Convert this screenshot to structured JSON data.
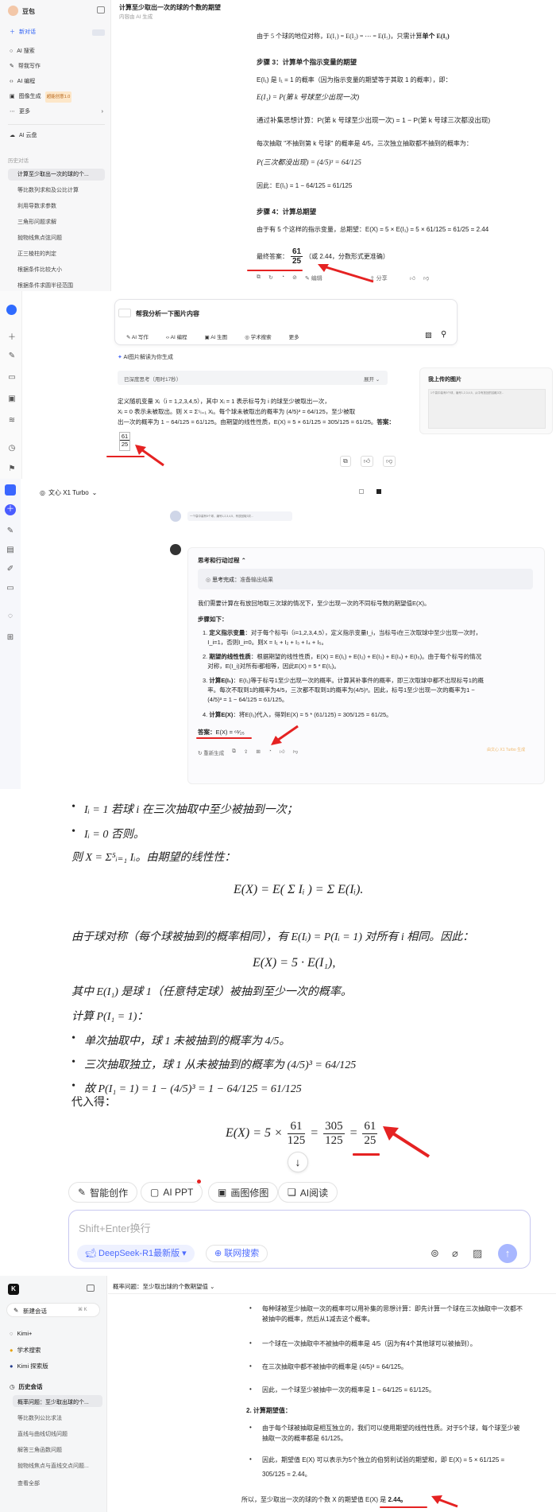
{
  "doubao": {
    "app_name": "豆包",
    "new_chat": "新对话",
    "nav": [
      "AI 搜索",
      "帮我写作",
      "AI 编程",
      "图像生成",
      "更多"
    ],
    "image_badge": "超能创意1.0",
    "cloud": "AI 云盘",
    "history_label": "历史对话",
    "history": [
      "计算至少取出一次的球的个...",
      "等比数列求和及公比计算",
      "利用导数求参数",
      "三角形问题求解",
      "抛物线焦点弦问题",
      "正三棱柱的判定",
      "根据条件比较大小",
      "根据条件求圆半径范围"
    ],
    "title": "计算至少取出一次的球的个数的期望",
    "subtitle": "内容由 AI 生成",
    "line1": "由于 5 个球的地位对称，E(I₁) = E(I₂) = ⋯ = E(I₅)，只需计算",
    "line1_bold": "单个 E(I₁)",
    "step3": "步骤 3：计算单个指示变量的期望",
    "s3a": "E(I₁) 是 I₁ = 1 的概率（因为指示变量的期望等于其取 1 的概率），即：",
    "s3b": "E(I₁) = P(第 k 号球至少出现一次)",
    "s3c": "通过补集思想计算：P(第 k 号球至少出现一次) = 1 − P(第 k 号球三次都没出现)",
    "s3c_bold": "补集思想",
    "s3d": "每次抽取 \"不抽到第 k 号球\" 的概率是 4/5，三次独立抽取都不抽到的概率为：",
    "s3e": "P(三次都没出现) = (4/5)³ = 64/125",
    "s3f": "因此：E(I₁) = 1 − 64/125 = 61/125",
    "step4": "步骤 4：计算总期望",
    "s4a": "由于有 5 个这样的指示变量，总期望：E(X) = 5 × E(I₁) = 5 × 61/125 = 61/25 = 2.44",
    "final_label": "最终答案：",
    "final_num": "61",
    "final_den": "25",
    "final_note": "（或 2.44，分数形式更准确）",
    "edit": "编辑",
    "share": "分享"
  },
  "baidu": {
    "input_placeholder": "帮我分析一下图片内容",
    "tools": [
      "AI 写作",
      "AI 编程",
      "AI 生图",
      "学术搜索",
      "更多"
    ],
    "ai_note": "AI图片解读为你生成",
    "think_label": "已深度思考（用时17秒）",
    "expand": "展开",
    "ans1": "定义随机变量 Xᵢ（i = 1,2,3,4,5），其中 Xᵢ = 1 表示标号为 i 的球至少被取出一次，",
    "ans2": "Xᵢ = 0 表示未被取出。则 X = Σ⁵ᵢ₌₁ Xᵢ。每个球未被取出的概率为 (4/5)³ = 64/125，至少被取",
    "ans3": "出一次的概率为 1 − 64/125 = 61/125。由期望的线性性质，E(X) = 5 × 61/125 = 305/125 = 61/25。",
    "ans3_bold": "答案：",
    "ans_num": "61",
    "ans_den": "25",
    "upload_title": "我上传的图片",
    "upload_caption": "1个袋中装有5个球，编号1,2,3,4,5，从中有放回的抽取3次..."
  },
  "wenxin": {
    "model": "文心 X1 Turbo",
    "user_msg": "一个袋中装有5个球，编号1,2,3,4,5，有放回取3次...",
    "process_label": "思考和行动过程",
    "done_label": "思考完成",
    "done_text": "准备输出结果",
    "intro": "我们需要计算在有放回地取三次球的情况下，至少出现一次的不同标号数的期望值E(X)。",
    "steps_label": "步骤如下：",
    "steps": [
      {
        "b": "定义指示变量",
        "t": "：对于每个标号i（i=1,2,3,4,5），定义指示变量I_i，当标号i在三次取球中至少出现一次时，",
        "t2": "I_i=1，否则I_i=0。则X = I₁ + I₂ + I₃ + I₄ + I₅。"
      },
      {
        "b": "期望的线性性质",
        "t": "：根据期望的线性性质，E(X) = E(I₁) + E(I₂) + E(I₃) + E(I₄) + E(I₅)。由于每个标号的情况",
        "t2": "对称，E(I_i)对所有i都相等，因此E(X) = 5 * E(I₁)。"
      },
      {
        "b": "计算E(I₁)",
        "t": "：E(I₁)等于标号1至少出现一次的概率。计算其补事件的概率，即三次取球中都不出现标号1的概",
        "t2": "率。每次不取到1的概率为4/5，三次都不取到1的概率为(4/5)³。因此，标号1至少出现一次的概率为1 −",
        "t3": "(4/5)³ = 1 − 64/125 = 61/125。"
      },
      {
        "b": "计算E(X)",
        "t": "：将E(I₁)代入，得到E(X) = 5 * (61/125) = 305/125 = 61/25。"
      }
    ],
    "answer_label": "答案：",
    "answer_value": "E(X) = ⁶¹⁄₂₅",
    "regen": "重新生成",
    "watermark": "由文心 X1 Turbo 生成"
  },
  "deepseek": {
    "b1": "Iᵢ = 1 若球 i 在三次抽取中至少被抽到一次；",
    "b2": "Iᵢ = 0 否则。",
    "then": "则 X = Σ⁵ᵢ₌₁ Iᵢ。由期望的线性性：",
    "eq1": "E(X) = E( Σ Iᵢ ) = Σ E(Iᵢ).",
    "sym": "由于球对称（每个球被抽到的概率相同），有 E(Iᵢ) = P(Iᵢ = 1) 对所有 i 相同。因此：",
    "eq2": "E(X) = 5 ·   E(I₁),",
    "where": "其中 E(I₁) 是球 1（任意特定球）被抽到至少一次的概率。",
    "calc": "计算 P(I₁ = 1)：",
    "c1": "单次抽取中，球 1 未被抽到的概率为 4/5。",
    "c2": "三次抽取独立，球 1 从未被抽到的概率为 (4/5)³ = 64/125",
    "c3": "故 P(I₁ = 1) = 1 − (4/5)³ = 1 − 64/125 = 61/125",
    "sub": "代入得：",
    "final_prefix": "E(X) = 5 ×",
    "f1n": "61",
    "f1d": "125",
    "f2n": "305",
    "f2d": "125",
    "f3n": "61",
    "f3d": "25",
    "chips": [
      "智能创作",
      "AI PPT",
      "画图修图",
      "AI阅读"
    ],
    "input_placeholder": "Shift+Enter换行",
    "model": "DeepSeek-R1最新版",
    "web_search": "联网搜索"
  },
  "kimi": {
    "new_chat": "新建会话",
    "shortcut": "⌘ K",
    "nav": [
      "Kimi+",
      "学术搜索",
      "Kimi 探索版"
    ],
    "history_label": "历史会话",
    "history": [
      "概率问题：至少取出球的个...",
      "等比数列公比求法",
      "直线与曲线切线问题",
      "解答三角函数问题",
      "抛物线焦点与直线交点问题..."
    ],
    "view_all": "查看全部",
    "title": "概率问题：至少取出球的个数期望值",
    "l1": "每种球被至少抽取一次的概率可以用补集的思想计算：即先计算一个球在三次抽取中一次都不",
    "l1b": "被抽中的概率，然后从1减去这个概率。",
    "l2": "一个球在一次抽取中不被抽中的概率是 4/5（因为有4个其他球可以被抽到）。",
    "l3": "在三次抽取中都不被抽中的概率是 (4/5)³ = 64/125。",
    "l4": "因此，一个球至少被抽中一次的概率是 1 − 64/125 = 61/125。",
    "h2": "2. 计算期望值：",
    "l5": "由于每个球被抽取是相互独立的，我们可以使用期望的线性性质。对于5个球，每个球至少被",
    "l5b": "抽取一次的概率都是 61/125。",
    "l6": "因此，期望值 E(X) 可以表示为5个独立的伯努利试验的期望和，即 E(X) = 5 × 61/125 =",
    "l6b": "305/125 = 2.44。",
    "conclusion": "所以，至少取出一次的球的个数 X 的期望值 E(X) 是",
    "conclusion_value": "2.44。"
  },
  "colors": {
    "accent_red": "#e52222",
    "doubao_blue": "#4a6cf7",
    "deepseek_blue": "#4d6bfe",
    "kimi_dark": "#1a1a1a"
  }
}
